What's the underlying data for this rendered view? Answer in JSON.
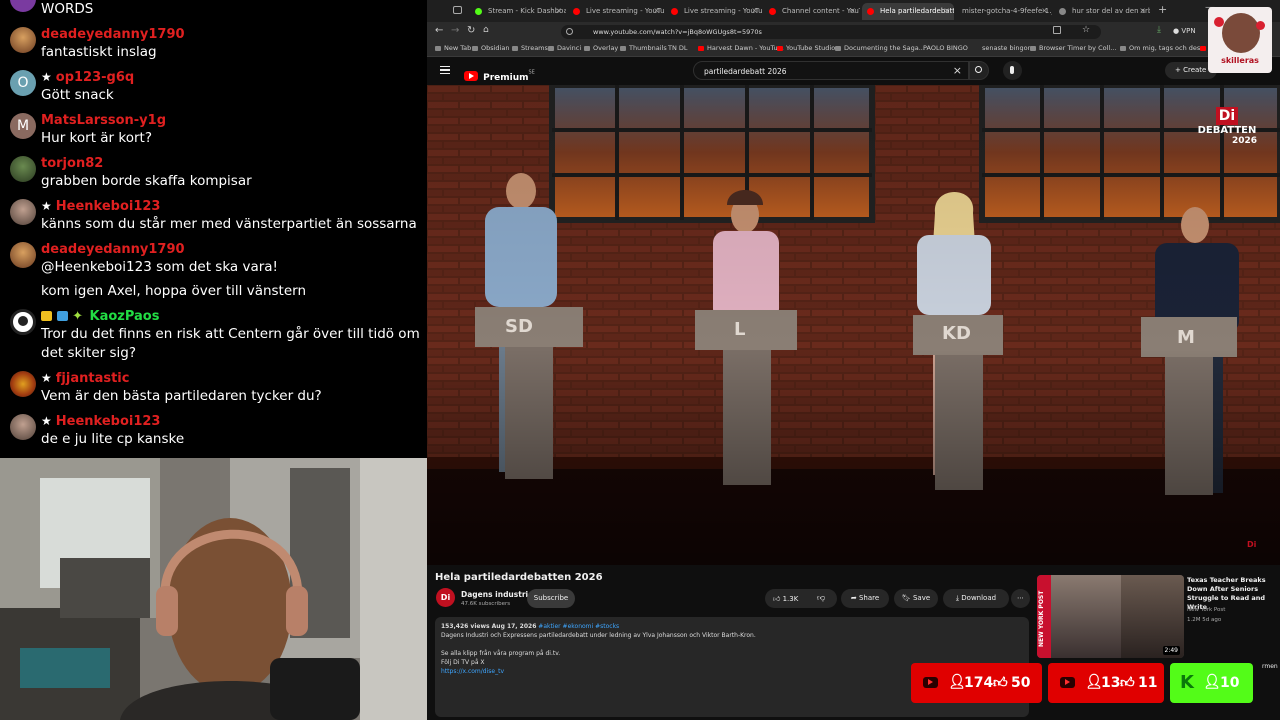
{
  "chat": {
    "top_fragment": "WORDS",
    "messages": [
      {
        "user": "deadeyedanny1790",
        "text": "fantastiskt inslag",
        "color": "#e02020",
        "star": false
      },
      {
        "user": "op123-g6q",
        "text": "Gött snack",
        "color": "#e02020",
        "star": true
      },
      {
        "user": "MatsLarsson-y1g",
        "text": "Hur kort är kort?",
        "color": "#e02020",
        "star": false
      },
      {
        "user": "torjon82",
        "text": "grabben borde skaffa kompisar",
        "color": "#e02020",
        "star": false
      },
      {
        "user": "Heenkeboi123",
        "text": "känns som du står mer med vänsterpartiet än sossarna",
        "color": "#e02020",
        "star": true
      },
      {
        "user": "deadeyedanny1790",
        "text": "@Heenkeboi123 som det ska vara!",
        "color": "#e02020",
        "star": false
      },
      {
        "user": "",
        "text": "kom igen Axel, hoppa över till vänstern",
        "color": "#e02020",
        "star": false
      },
      {
        "user": "KaozPaos",
        "text": "Tror du det finns en risk att Centern går över till tidö om det skiter sig?",
        "color": "#22dd44",
        "star": false
      },
      {
        "user": "fjjantastic",
        "text": "Vem är den bästa partiledaren tycker du?",
        "color": "#e02020",
        "star": true
      },
      {
        "user": "Heenkeboi123",
        "text": "de e ju lite cp kanske",
        "color": "#e02020",
        "star": true
      }
    ]
  },
  "browser": {
    "tabs": [
      {
        "title": "Stream - Kick Dashboard",
        "color": "#53fc18"
      },
      {
        "title": "Live streaming - YouTube",
        "color": "#ff0000"
      },
      {
        "title": "Live streaming - YouTube",
        "color": "#ff0000"
      },
      {
        "title": "Channel content - YouTube",
        "color": "#ff0000"
      },
      {
        "title": "Hela partiledardebatt",
        "color": "#ff0000"
      },
      {
        "title": "mister-gotcha-4-9feefe-1.jpg",
        "color": "#888888"
      },
      {
        "title": "hur stor del av den arbetande",
        "color": "#888888"
      }
    ],
    "url": "www.youtube.com/watch?v=jBq8oWGUgs8t=5970s",
    "vpn": "VPN",
    "bookmarks": [
      "New Tab",
      "Obsidian",
      "Streams",
      "Davinci",
      "Overlay",
      "Thumbnails",
      "TN DL",
      "Harvest Dawn - YouTu...",
      "YouTube Studio",
      "Documenting the Saga...",
      "PAOLO BINGO",
      "senaste bingon",
      "Browser Timer by Coll...",
      "Om mig, tags och des...",
      "Yo"
    ]
  },
  "youtube": {
    "logo": "Premium",
    "logo_sup": "SE",
    "search": "partiledardebatt 2026",
    "create": "Create",
    "title": "Hela partiledardebatten 2026",
    "channel": "Dagens industri",
    "subs": "47.6K subscribers",
    "subscribe": "Subscribe",
    "likes": "1.3K",
    "share": "Share",
    "save": "Save",
    "download": "Download",
    "views": "153,426 views  Aug 17, 2026",
    "tags": "#aktier #ekonomi #stocks",
    "desc1": "Dagens Industri och Expressens partiledardebatt under ledning av Ylva Johansson och Viktor Barth-Kron.",
    "desc2": "Se alla klipp från våra program på di.tv.",
    "desc3": "Följ Di TV på X",
    "desc4": "https://x.com/dise_tv",
    "rec_title": "Texas Teacher Breaks Down After Seniors Struggle to Read and Write",
    "rec_channel": "New York Post",
    "rec_meta": "1.2M  5d ago",
    "rec_duration": "2:49",
    "rec_side": "NEW YORK POST",
    "next_fragment": "rmen"
  },
  "video": {
    "podiums": [
      "SD",
      "L",
      "KD",
      "M"
    ],
    "brand_logo": "Di",
    "brand_title": "DEBATTEN",
    "brand_year": "2026"
  },
  "overlay": {
    "sticker": "skilleras"
  },
  "stats": [
    {
      "viewers": "174",
      "likes": "50",
      "platform": "youtube"
    },
    {
      "viewers": "13",
      "likes": "11",
      "platform": "youtube"
    },
    {
      "viewers": "10",
      "platform": "kick"
    }
  ]
}
